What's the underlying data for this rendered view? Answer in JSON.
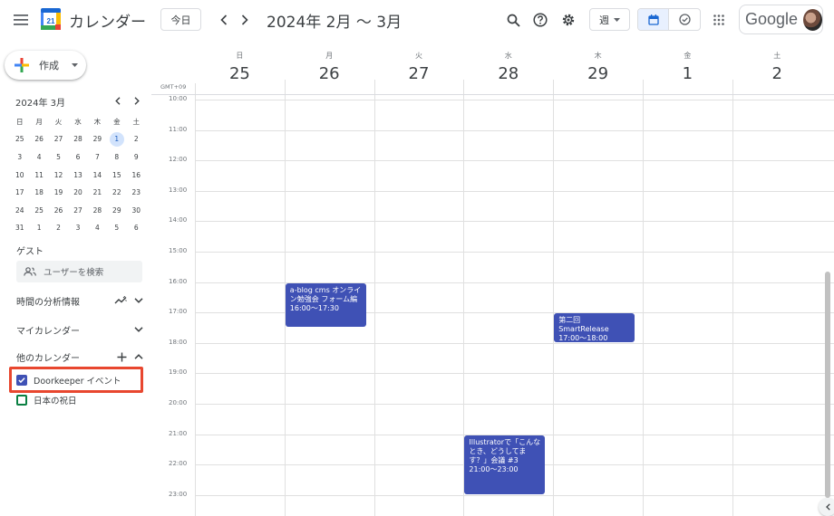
{
  "header": {
    "app_title": "カレンダー",
    "logo_day": "21",
    "today_label": "今日",
    "date_range": "2024年 2月 〜 3月",
    "view_label": "週",
    "brand": "Google"
  },
  "sidebar": {
    "create_label": "作成",
    "mini_title": "2024年 3月",
    "weekdays": [
      "日",
      "月",
      "火",
      "水",
      "木",
      "金",
      "土"
    ],
    "weeks": [
      [
        "25",
        "26",
        "27",
        "28",
        "29",
        "1",
        "2"
      ],
      [
        "3",
        "4",
        "5",
        "6",
        "7",
        "8",
        "9"
      ],
      [
        "10",
        "11",
        "12",
        "13",
        "14",
        "15",
        "16"
      ],
      [
        "17",
        "18",
        "19",
        "20",
        "21",
        "22",
        "23"
      ],
      [
        "24",
        "25",
        "26",
        "27",
        "28",
        "29",
        "30"
      ],
      [
        "31",
        "1",
        "2",
        "3",
        "4",
        "5",
        "6"
      ]
    ],
    "guest_label": "ゲスト",
    "guest_search_placeholder": "ユーザーを検索",
    "analytics_label": "時間の分析情報",
    "my_calendars_label": "マイカレンダー",
    "other_calendars_label": "他のカレンダー",
    "calendars": [
      {
        "name": "Doorkeeper イベント",
        "checked": true,
        "color": "#3f51b5"
      },
      {
        "name": "日本の祝日",
        "checked": false,
        "color": "#0b8043"
      }
    ]
  },
  "grid": {
    "timezone": "GMT+09",
    "days": [
      {
        "name": "日",
        "num": "25"
      },
      {
        "name": "月",
        "num": "26"
      },
      {
        "name": "火",
        "num": "27"
      },
      {
        "name": "水",
        "num": "28"
      },
      {
        "name": "木",
        "num": "29"
      },
      {
        "name": "金",
        "num": "1"
      },
      {
        "name": "土",
        "num": "2"
      }
    ],
    "hours": [
      "10:00",
      "11:00",
      "12:00",
      "13:00",
      "14:00",
      "15:00",
      "16:00",
      "17:00",
      "18:00",
      "19:00",
      "20:00",
      "21:00",
      "22:00",
      "23:00"
    ],
    "events": [
      {
        "day": 1,
        "start": 16.0,
        "end": 17.5,
        "title": "a-blog cms オンライン勉強会 フォーム編",
        "time": "16:00〜17:30"
      },
      {
        "day": 4,
        "start": 17.0,
        "end": 18.0,
        "title": "第二回 SmartRelease",
        "time": "17:00〜18:00"
      },
      {
        "day": 3,
        "start": 21.0,
        "end": 23.0,
        "title": "Illustratorで「こんなとき、どうしてます？」会議 #3",
        "time": "21:00〜23:00"
      }
    ]
  },
  "colors": {
    "event": "#3f51b5",
    "highlight": "#e8472f",
    "selected_day": "#d2e3fc"
  }
}
